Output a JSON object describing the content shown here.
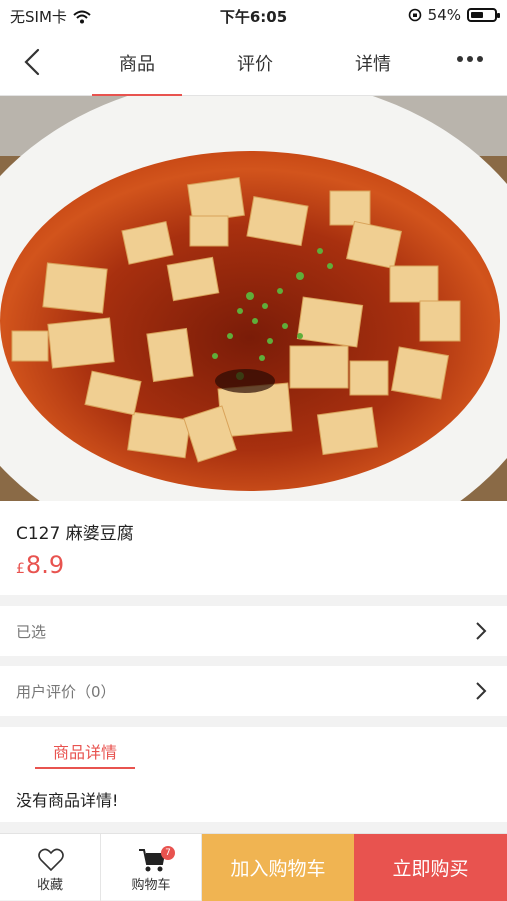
{
  "status_bar": {
    "carrier": "无SIM卡",
    "time": "下午6:05",
    "battery_pct": "54%",
    "battery_level": 0.54
  },
  "nav": {
    "tabs": [
      "商品",
      "评价",
      "详情"
    ],
    "active_tab": 0
  },
  "product": {
    "code_name": "C127 麻婆豆腐",
    "currency": "£",
    "price": "8.9"
  },
  "rows": {
    "selected_label": "已选",
    "reviews_label": "用户评价（0）"
  },
  "details": {
    "tab_label": "商品详情",
    "text": "没有商品详情!"
  },
  "bottom": {
    "favorite_label": "收藏",
    "cart_label": "购物车",
    "cart_count": "7",
    "add_to_cart_label": "加入购物车",
    "buy_now_label": "立即购买"
  },
  "colors": {
    "accent": "#e8534f",
    "add_cart": "#f0b452"
  }
}
